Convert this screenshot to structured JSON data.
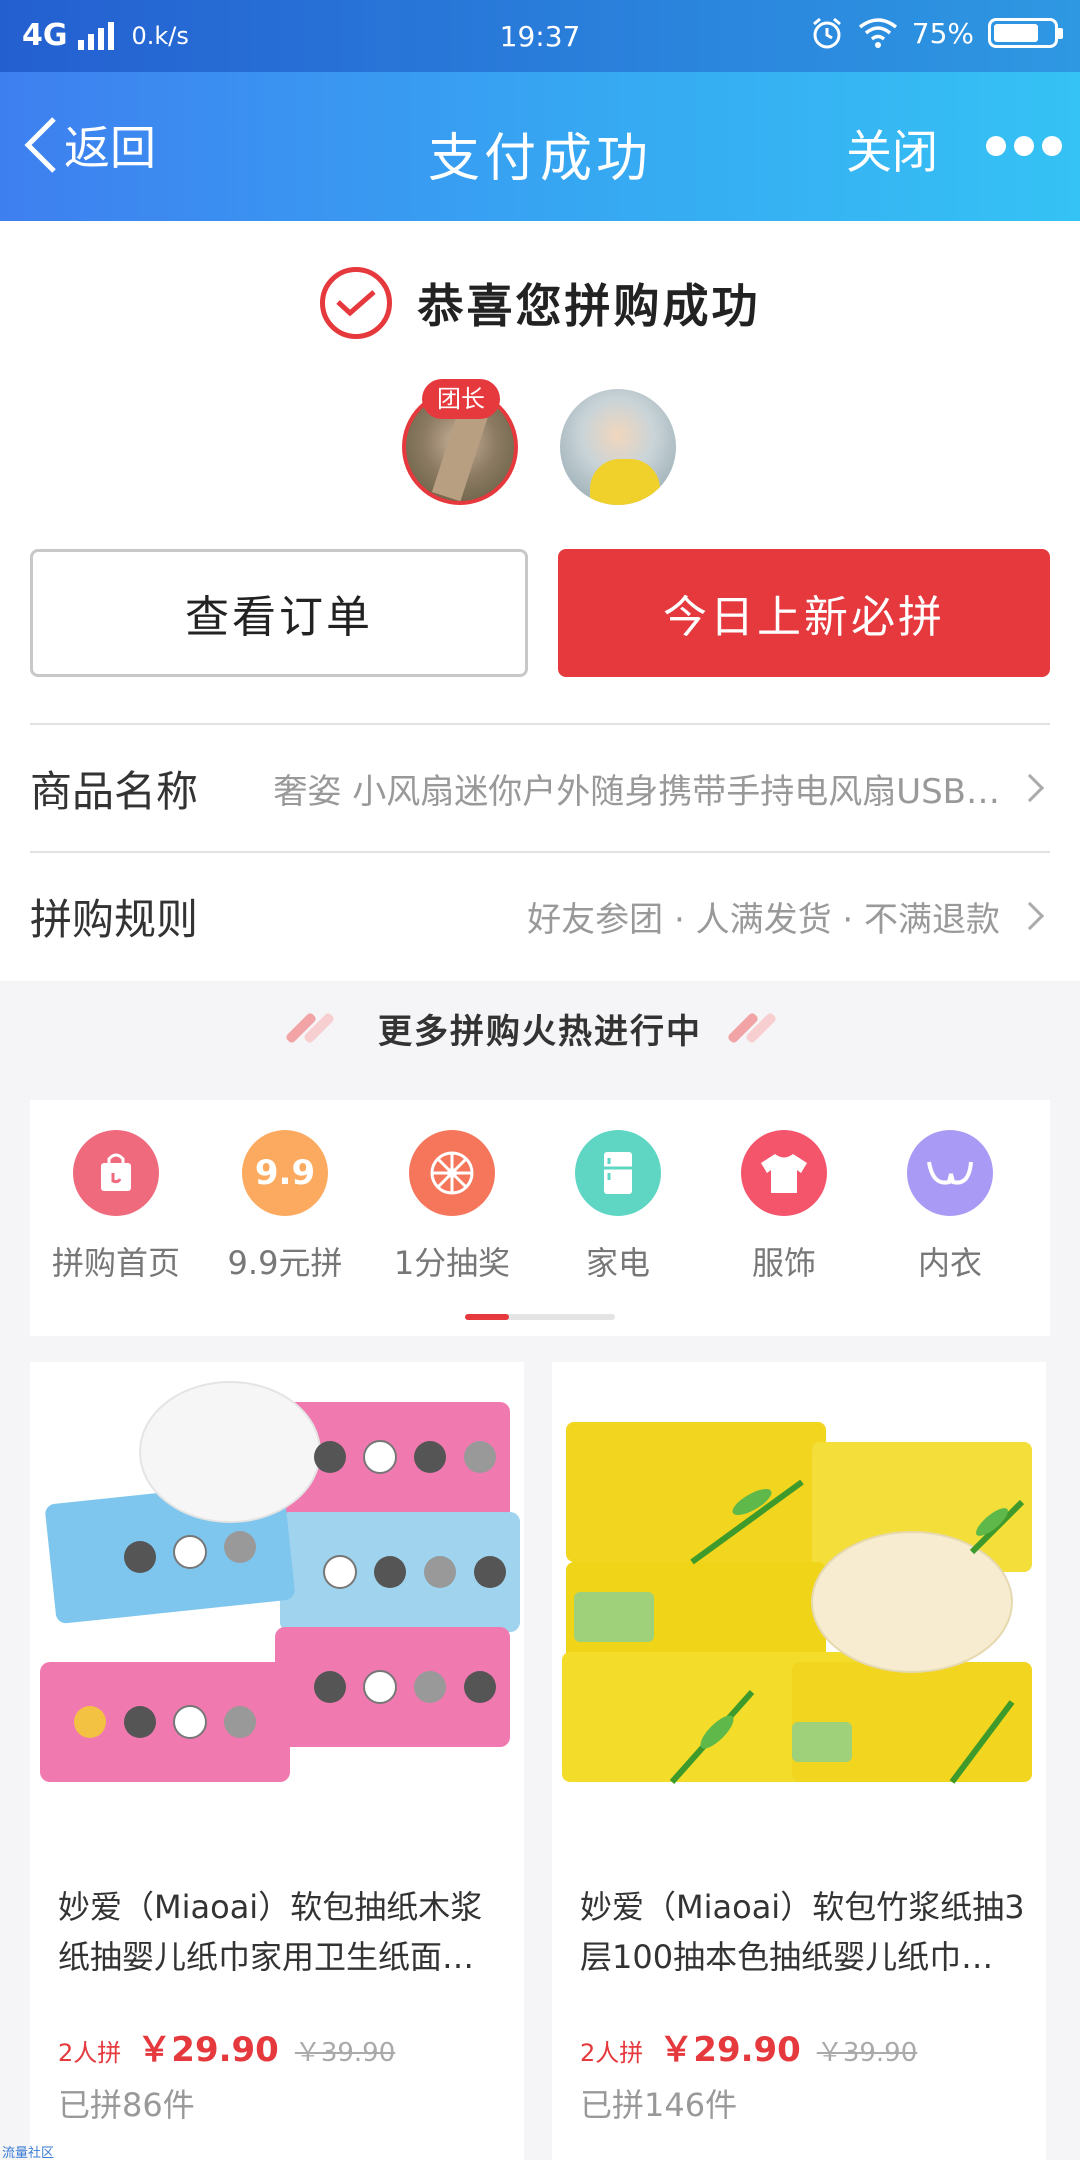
{
  "status_bar": {
    "network": "4G",
    "speed": "0.k/s",
    "time": "19:37",
    "battery": "75%"
  },
  "nav": {
    "back_label": "返回",
    "title": "支付成功",
    "close_label": "关闭"
  },
  "success": {
    "message": "恭喜您拼购成功",
    "leader_badge": "团长"
  },
  "buttons": {
    "view_order": "查看订单",
    "daily_new": "今日上新必拼"
  },
  "rows": {
    "product_name": {
      "label": "商品名称",
      "value": "奢姿 小风扇迷你户外随身携带手持电风扇USB…"
    },
    "group_rule": {
      "label": "拼购规则",
      "value": "好友参团 · 人满发货 · 不满退款"
    }
  },
  "more": {
    "title": "更多拼购火热进行中"
  },
  "categories": [
    {
      "label": "拼购首页",
      "icon": "shopping-bag-icon",
      "color": "#f06a7d"
    },
    {
      "label": "9.9元拼",
      "icon": "9.9",
      "color": "#fbaa60"
    },
    {
      "label": "1分抽奖",
      "icon": "wheel-icon",
      "color": "#f6765b"
    },
    {
      "label": "家电",
      "icon": "fridge-icon",
      "color": "#5fd6c4"
    },
    {
      "label": "服饰",
      "icon": "tshirt-icon",
      "color": "#f4556b"
    },
    {
      "label": "内衣",
      "icon": "bra-icon",
      "color": "#a99bf5"
    }
  ],
  "products": [
    {
      "title": "妙爱（Miaoai）软包抽纸木浆纸抽婴儿纸巾家用卫生纸面…",
      "group_size": "2人拼",
      "price": "￥29.90",
      "original_price": "￥39.90",
      "sold": "已拼86件"
    },
    {
      "title": "妙爱（Miaoai）软包竹浆纸抽3层100抽本色抽纸婴儿纸巾…",
      "group_size": "2人拼",
      "price": "￥29.90",
      "original_price": "￥39.90",
      "sold": "已拼146件"
    }
  ],
  "watermark": "流量社区"
}
